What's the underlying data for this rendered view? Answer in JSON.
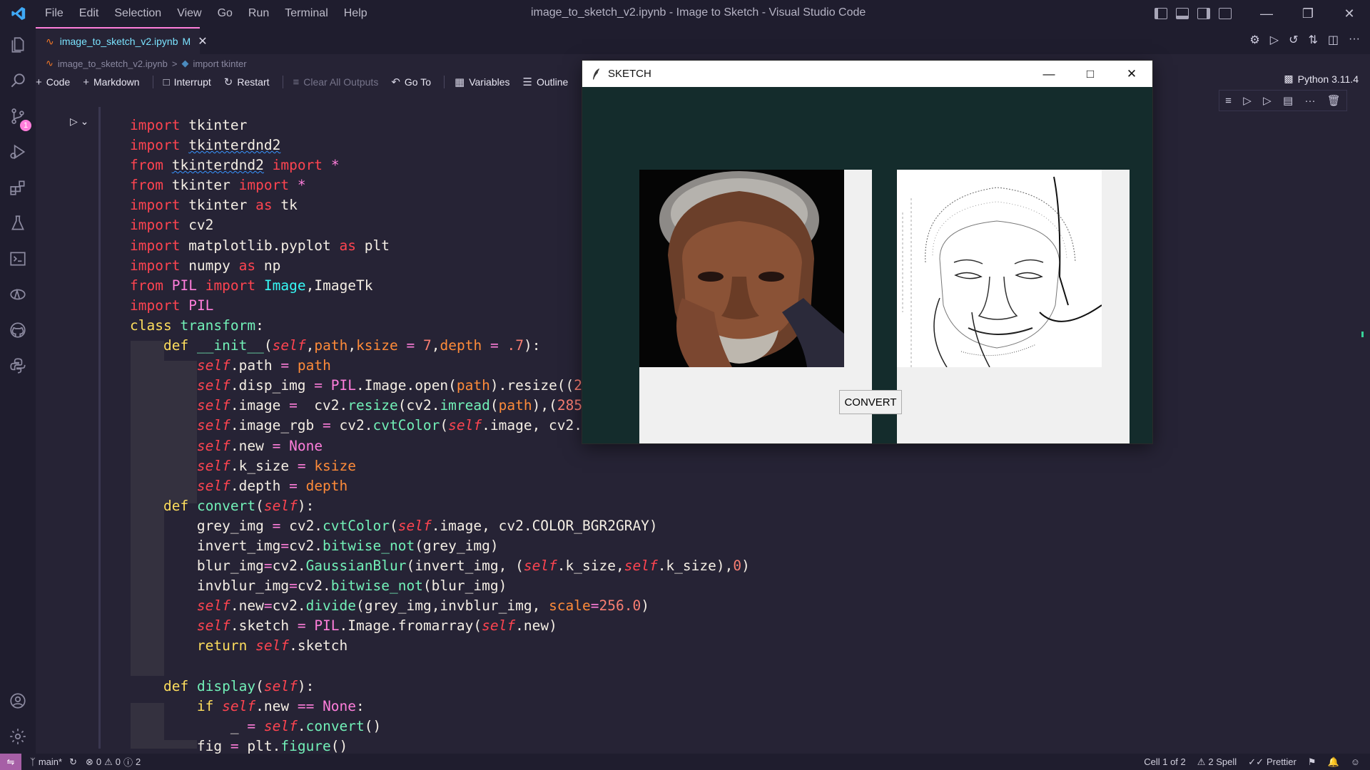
{
  "window": {
    "title": "image_to_sketch_v2.ipynb - Image to Sketch - Visual Studio Code",
    "menu": [
      "File",
      "Edit",
      "Selection",
      "View",
      "Go",
      "Run",
      "Terminal",
      "Help"
    ]
  },
  "tab": {
    "label": "image_to_sketch_v2.ipynb",
    "modified": "M"
  },
  "breadcrumb": {
    "file": "image_to_sketch_v2.ipynb",
    "sep": ">",
    "symbol": "import tkinter"
  },
  "toolbar": {
    "code": "Code",
    "markdown": "Markdown",
    "interrupt": "Interrupt",
    "restart": "Restart",
    "clear_all": "Clear All Outputs",
    "go_to": "Go To",
    "variables": "Variables",
    "outline": "Outline",
    "more": "···"
  },
  "kernel": "Python 3.11.4",
  "source_control_badge": "1",
  "tk_window": {
    "title": "SKETCH",
    "convert": "CONVERT",
    "original_image": "portrait photo",
    "sketch_image": "pencil sketch of portrait"
  },
  "statusbar": {
    "branch": "main*",
    "errors": "0",
    "warnings": "0",
    "infos": "2",
    "cell": "Cell 1 of 2",
    "spell": "2 Spell",
    "prettier": "Prettier"
  },
  "colors": {
    "background": "#262335",
    "chrome": "#1f1d2e",
    "accent": "#ff7edb",
    "tk_bg": "#142c2c"
  }
}
